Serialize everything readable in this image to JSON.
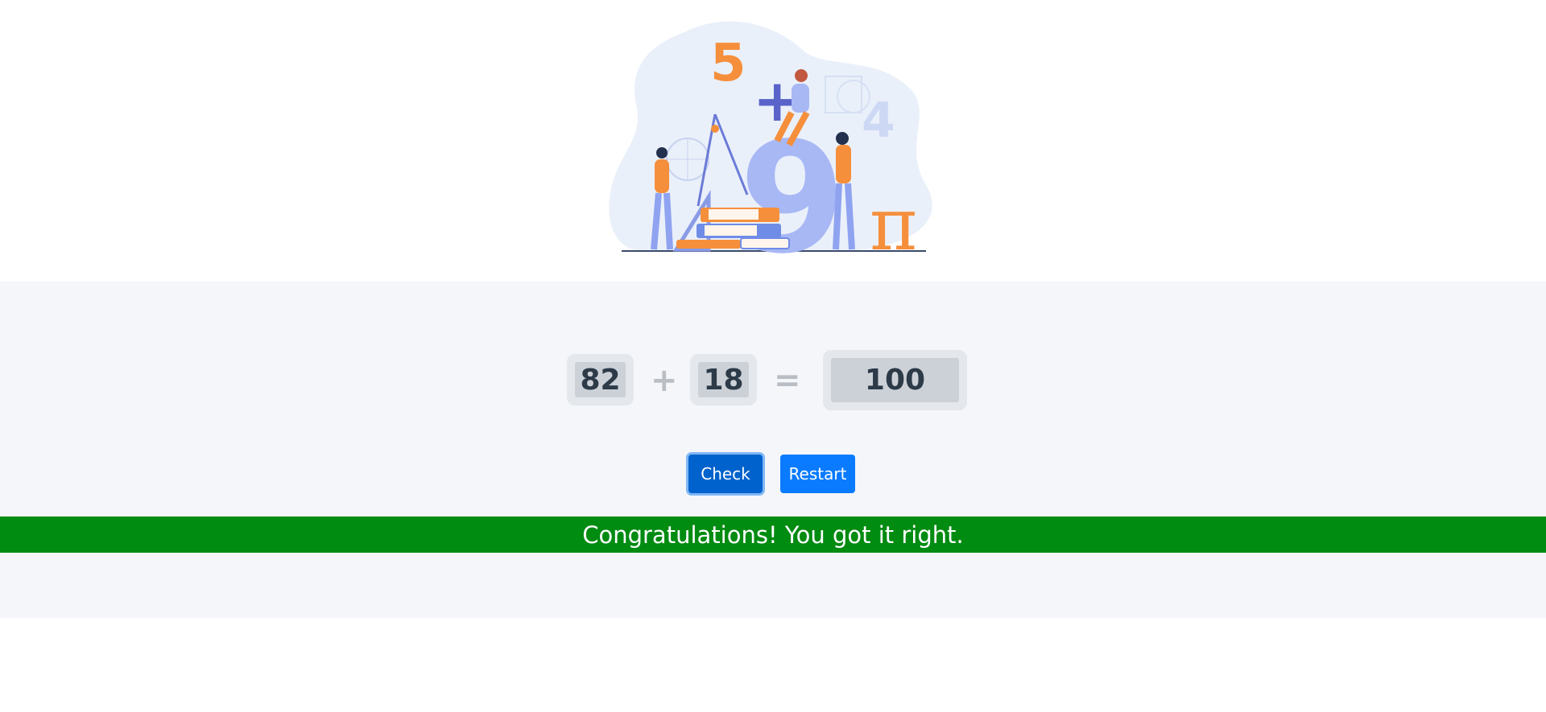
{
  "illustration": {
    "icon": "math-illustration",
    "digits": [
      "5",
      "4",
      "9"
    ],
    "symbols": [
      "+",
      "π"
    ]
  },
  "equation": {
    "operand1": "82",
    "operator": "+",
    "operand2": "18",
    "equals": "=",
    "answer": "100"
  },
  "buttons": {
    "check_label": "Check",
    "restart_label": "Restart"
  },
  "result": {
    "message": "Congratulations! You got it right."
  },
  "colors": {
    "panel_bg": "#f4f6f9",
    "success_bg": "#008b11",
    "primary": "#0a7bff",
    "primary_active": "#0062cc",
    "accent_orange": "#f58f3c",
    "accent_blue": "#a8b8f5"
  }
}
